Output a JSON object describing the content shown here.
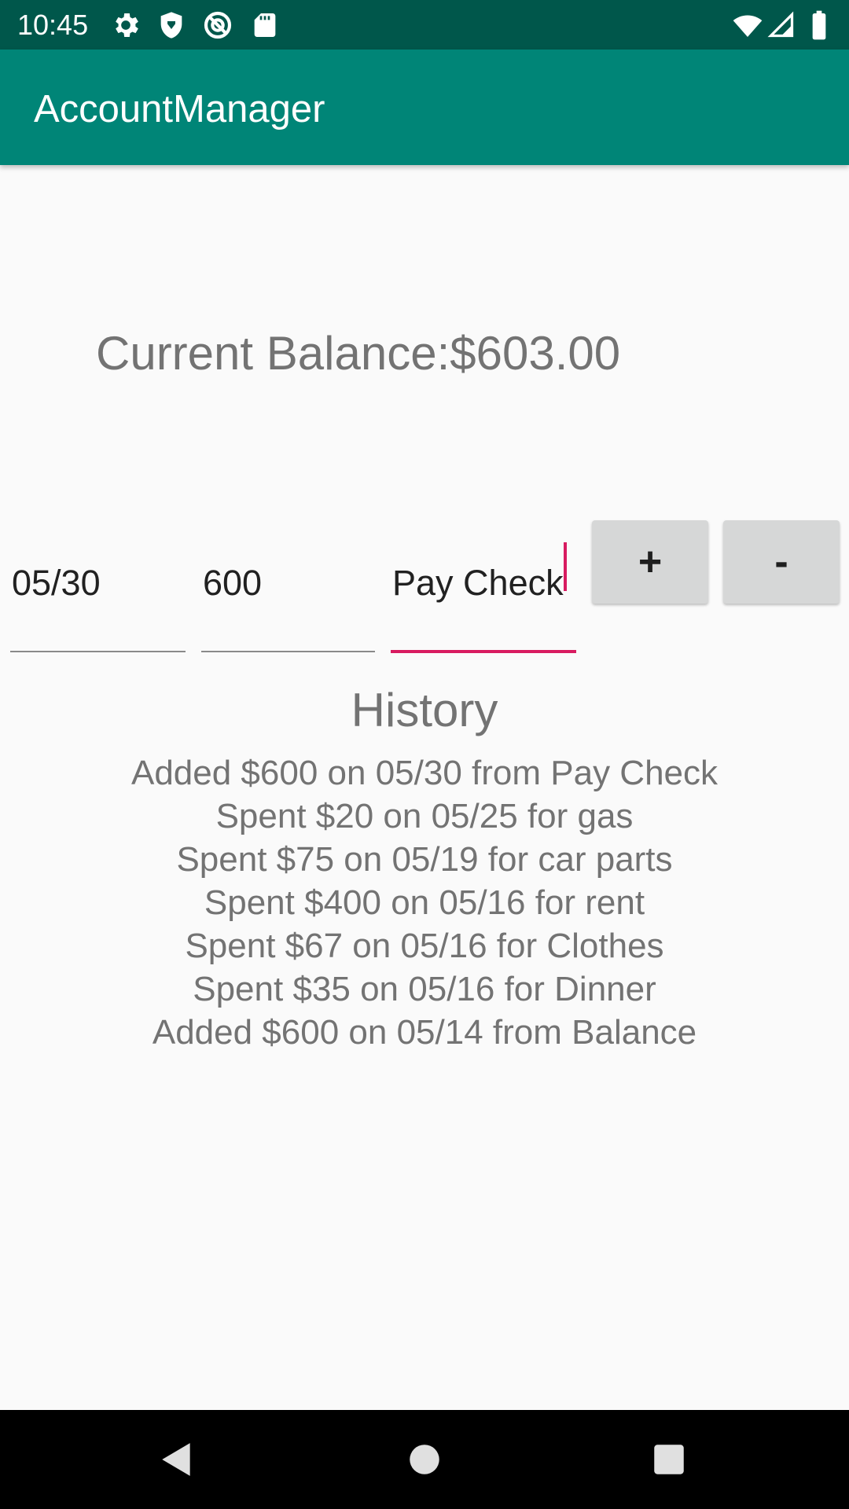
{
  "status_bar": {
    "time": "10:45",
    "icons_left": [
      "settings-icon",
      "shield-icon",
      "sync-off-icon",
      "sd-card-icon"
    ],
    "icons_right": [
      "wifi-icon",
      "cell-signal-icon",
      "battery-icon"
    ]
  },
  "app_bar": {
    "title": "AccountManager",
    "color": "#008577"
  },
  "balance": {
    "text": "Current Balance:$603.00"
  },
  "inputs": {
    "date_value": "05/30",
    "amount_value": "600",
    "description_value": "Pay Check"
  },
  "buttons": {
    "add_label": "+",
    "subtract_label": "-"
  },
  "history": {
    "title": "History",
    "entries": [
      "Added $600 on 05/30 from Pay Check",
      "Spent $20 on 05/25 for gas",
      "Spent $75 on 05/19 for car parts",
      "Spent $400 on 05/16 for rent",
      "Spent $67 on 05/16 for Clothes",
      "Spent $35 on 05/16 for Dinner",
      "Added $600 on 05/14 from Balance"
    ]
  },
  "nav_bar": {
    "icons": [
      "back-icon",
      "home-icon",
      "recents-icon"
    ]
  },
  "colors": {
    "status_bar": "#00574b",
    "accent": "#d81b60",
    "text_secondary": "#737373",
    "button_bg": "#d6d7d7"
  }
}
